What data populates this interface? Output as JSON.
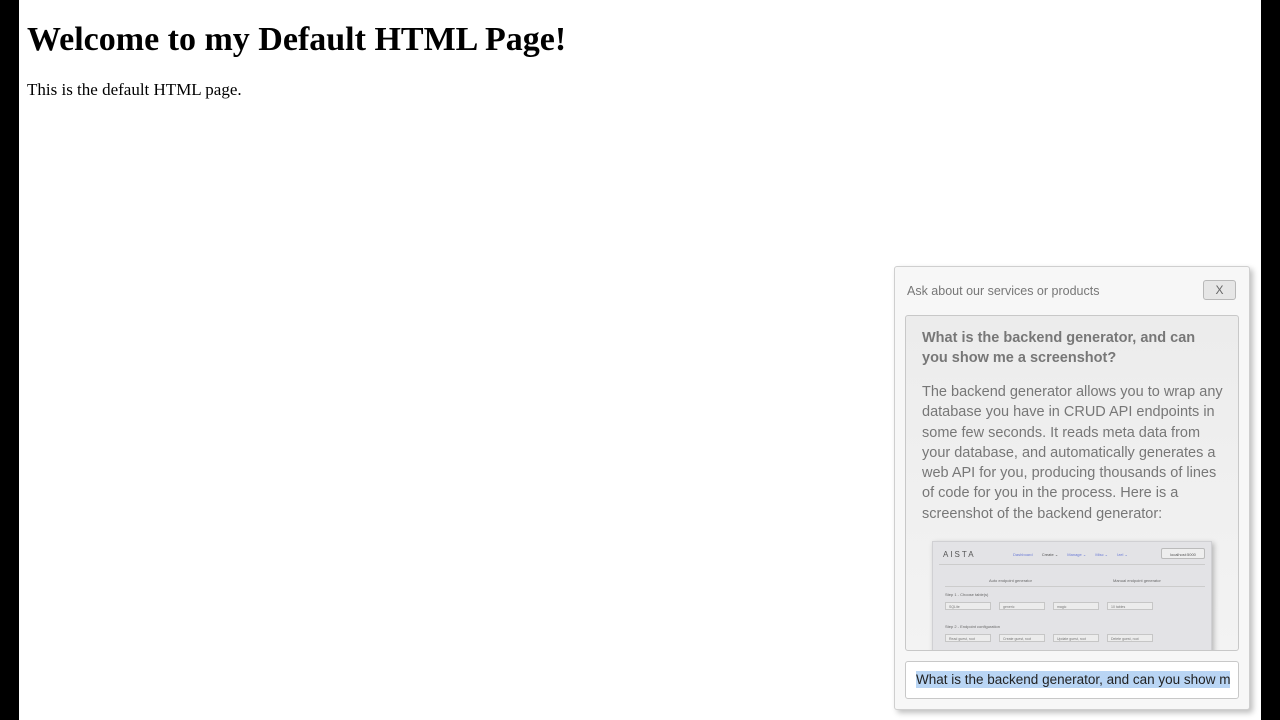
{
  "page": {
    "heading": "Welcome to my Default HTML Page!",
    "intro": "This is the default HTML page."
  },
  "chat": {
    "header": "Ask about our services or products",
    "close_label": "X",
    "question": "What is the backend generator, and can you show me a screenshot?",
    "answer": "The backend generator allows you to wrap any database you have in CRUD API endpoints in some few seconds. It reads meta data from your database, and automatically generates a web API for you, producing thousands of lines of code for you in the process. Here is a screenshot of the backend generator:",
    "screenshot": {
      "logo": "AISTA",
      "nav": [
        "Dashboard",
        "Create ⌄",
        "Manage ⌄",
        "Misc ⌄",
        "Izel ⌄"
      ],
      "host": "localhost:5000",
      "col_auto": "Auto endpoint generator",
      "col_manual": "Manual endpoint generator",
      "step1": "Step 1 - Choose table(s)",
      "step1_fields": [
        "SQLite",
        "generic",
        "magic",
        "10 tables"
      ],
      "step2": "Step 2 - Endpoint configuration",
      "step2_fields": [
        "Read  guest, root",
        "Create  guest, root",
        "Update  guest, root",
        "Delete  guest, root"
      ]
    },
    "input_value": "What is the backend generator, and can you show me a screenshot?"
  },
  "colors": {
    "page_background": "#ffffff",
    "frame": "#000000",
    "selection": "#b9d5f4"
  }
}
